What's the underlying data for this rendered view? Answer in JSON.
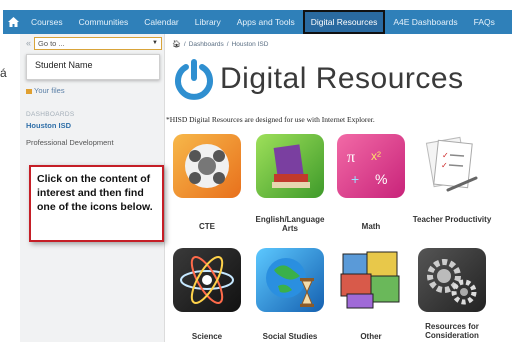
{
  "nav": {
    "items": [
      "Courses",
      "Communities",
      "Calendar",
      "Library",
      "Apps and Tools",
      "Digital Resources",
      "A4E Dashboards",
      "FAQs"
    ],
    "active": "Digital Resources"
  },
  "stray_char": "á",
  "sidebar": {
    "collapse_glyph": "«",
    "goto_placeholder": "Go to ...",
    "student_name": "Student Name",
    "your_files": "Your files",
    "dashboards_heading": "DASHBOARDS",
    "dashboards": [
      "Houston ISD",
      "Professional Development"
    ]
  },
  "callout": "Click on the content of interest and then find one of the icons below.",
  "breadcrumb": [
    "Dashboards",
    "Houston ISD"
  ],
  "page": {
    "title": "Digital Resources",
    "note": "*HISD Digital Resources are designed for use with Internet Explorer."
  },
  "resources": [
    {
      "label": "CTE",
      "icon": "cte-icon"
    },
    {
      "label": "English/Language Arts",
      "icon": "english-books-icon"
    },
    {
      "label": "Math",
      "icon": "math-icon"
    },
    {
      "label": "Teacher Productivity",
      "icon": "checklist-icon"
    },
    {
      "label": "Science",
      "icon": "atom-icon"
    },
    {
      "label": "Social Studies",
      "icon": "globe-hourglass-icon"
    },
    {
      "label": "Other",
      "icon": "collage-icon"
    },
    {
      "label": "Resources for Consideration",
      "icon": "gears-icon"
    }
  ],
  "colors": {
    "nav_bg": "#2f80b9",
    "nav_active": "#2a6aa0",
    "callout_border": "#c51e26",
    "logo_blue": "#2f8fd0",
    "link_blue": "#2f6fa8"
  }
}
